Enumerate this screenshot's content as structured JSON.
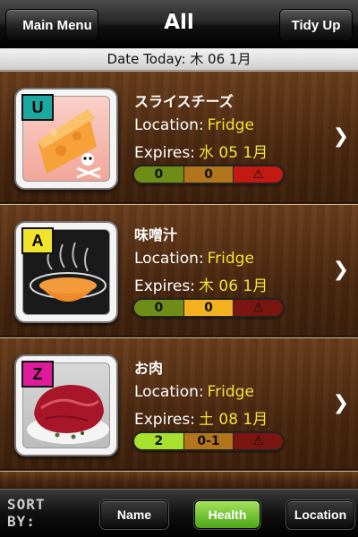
{
  "nav": {
    "back_label": "Main Menu",
    "title": "All",
    "tidy_label": "Tidy Up"
  },
  "date_bar": {
    "text": "Date Today: 木 06 1月"
  },
  "labels": {
    "location": "Location:",
    "expires": "Expires:"
  },
  "items": [
    {
      "name": "スライスチーズ",
      "badge": "U",
      "badge_color": "#1aa9a0",
      "icon": "cheese-icon",
      "location": "Fridge",
      "expires": "水 05 1月",
      "meter": [
        "0",
        "0",
        "⚠"
      ],
      "meter_colors": [
        "#6f8d16",
        "#b2751c",
        "#c21a12"
      ]
    },
    {
      "name": "味噌汁",
      "badge": "A",
      "badge_color": "#f0e32c",
      "icon": "soup-icon",
      "location": "Fridge",
      "expires": "木 06 1月",
      "meter": [
        "0",
        "0",
        "⚠"
      ],
      "meter_colors": [
        "#6f8d16",
        "#f3b21d",
        "#7a160f"
      ]
    },
    {
      "name": "お肉",
      "badge": "Z",
      "badge_color": "#e01b9b",
      "icon": "meat-icon",
      "location": "Fridge",
      "expires": "土 08 1月",
      "meter": [
        "2",
        "0-1",
        "⚠"
      ],
      "meter_colors": [
        "#a8e030",
        "#b2751c",
        "#7a160f"
      ]
    }
  ],
  "sort_bar": {
    "label": "SORT BY:",
    "buttons": [
      "Name",
      "Health",
      "Location"
    ],
    "active": "Health"
  },
  "colors": {
    "value_yellow": "#f1e43c",
    "active_green": "#4da617"
  }
}
